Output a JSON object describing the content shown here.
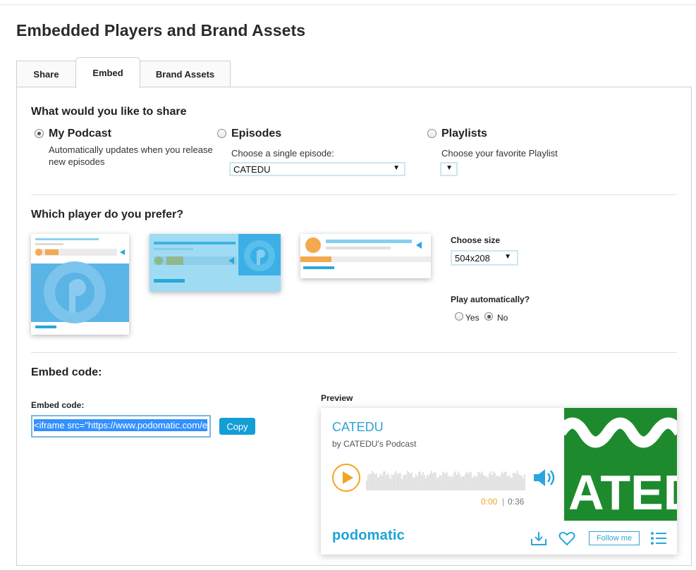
{
  "page": {
    "title": "Embedded Players and Brand Assets"
  },
  "tabs": [
    {
      "label": "Share",
      "active": false
    },
    {
      "label": "Embed",
      "active": true
    },
    {
      "label": "Brand Assets",
      "active": false
    }
  ],
  "share": {
    "heading": "What would you like to share",
    "options": [
      {
        "label": "My Podcast",
        "description": "Automatically updates when you release new episodes",
        "checked": true
      },
      {
        "label": "Episodes",
        "sublabel": "Choose a single episode:",
        "select_value": "CATEDU",
        "checked": false
      },
      {
        "label": "Playlists",
        "sublabel": "Choose your favorite Playlist",
        "select_value": "",
        "checked": false
      }
    ]
  },
  "player_choice": {
    "heading": "Which player do you prefer?",
    "size_label": "Choose size",
    "size_value": "504x208",
    "autoplay_label": "Play automatically?",
    "autoplay_options": [
      {
        "label": "Yes",
        "checked": false
      },
      {
        "label": "No",
        "checked": true
      }
    ]
  },
  "embed": {
    "heading": "Embed code:",
    "field_label": "Embed code:",
    "code_value": "<iframe src=\"https://www.podomatic.com/e",
    "copy_label": "Copy",
    "preview_label": "Preview"
  },
  "preview_player": {
    "title": "CATEDU",
    "byline": "by CATEDU's Podcast",
    "time_current": "0:00",
    "time_separator": "|",
    "time_total": "0:36",
    "brand": "podomatic",
    "follow_label": "Follow me",
    "cover_text": "ATED",
    "colors": {
      "accent": "#2fa3d6",
      "play": "#f3a521",
      "cover_bg": "#1e8a2e"
    }
  },
  "colors": {
    "tab_border": "#cfcfcf",
    "copy_button": "#139ed5",
    "thumb_blue": "#5ab4e6"
  }
}
